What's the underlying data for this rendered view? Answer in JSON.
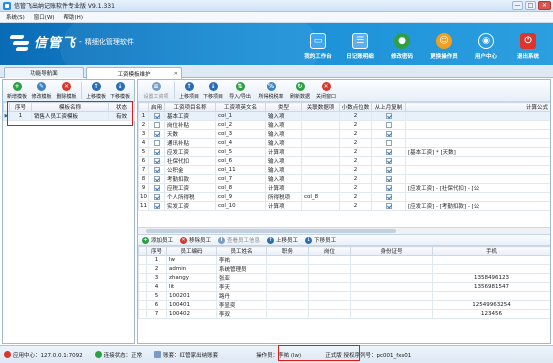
{
  "window": {
    "title": "信管飞出纳记账软件专业版 V9.1.331",
    "minimize": "—",
    "maximize": "□",
    "close": "✕"
  },
  "menu": [
    "系统(S)",
    "窗口(W)",
    "帮助(H)"
  ],
  "banner": {
    "brand": "信管飞",
    "separator": "-",
    "slogan": "精细化管理软件",
    "tools": [
      {
        "label": "我的工作台",
        "icon": "monitor-icon",
        "color": "#3fa7f0"
      },
      {
        "label": "日记账明细",
        "icon": "list-icon",
        "color": "#5cb0ee"
      },
      {
        "label": "修改密码",
        "icon": "lock-icon",
        "color": "#2ea043"
      },
      {
        "label": "更换操作员",
        "icon": "user-icon",
        "color": "#f0a020"
      },
      {
        "label": "用户中心",
        "icon": "globe-icon",
        "color": "#2a9de0"
      },
      {
        "label": "退出系统",
        "icon": "power-icon",
        "color": "#e0342a"
      }
    ]
  },
  "tabs": [
    {
      "label": "功能导航面"
    },
    {
      "label": "工资模板维护",
      "close": "✕"
    }
  ],
  "left_toolbar": [
    {
      "label": "新增模板",
      "color": "#2ea043",
      "glyph": "+"
    },
    {
      "label": "修改模板",
      "color": "#3b82c8",
      "glyph": "✎"
    },
    {
      "label": "删除模板",
      "color": "#d9362c",
      "glyph": "✕"
    },
    {
      "label": "上移模板",
      "color": "#2a6db3",
      "glyph": "↑"
    },
    {
      "label": "下移模板",
      "color": "#2a6db3",
      "glyph": "↓"
    }
  ],
  "template_table": {
    "headers": [
      "序号",
      "模板名称",
      "状态"
    ],
    "rows": [
      {
        "marker": "▶",
        "no": "1",
        "name": "销售人员工资模板",
        "status": "有效"
      }
    ]
  },
  "right_toolbar": [
    {
      "label": "设置工资项",
      "color": "#7a9cc4",
      "glyph": "≡",
      "disabled": true
    },
    {
      "label": "上移项目",
      "color": "#2a6db3",
      "glyph": "↑"
    },
    {
      "label": "下移项目",
      "color": "#2a6db3",
      "glyph": "↓"
    },
    {
      "label": "导入/导出",
      "color": "#2ea043",
      "glyph": "⇅"
    },
    {
      "label": "所得税税率",
      "color": "#3b82c8",
      "glyph": "%"
    },
    {
      "label": "刷新数据",
      "color": "#2ea043",
      "glyph": "↻"
    },
    {
      "label": "关闭窗口",
      "color": "#d9362c",
      "glyph": "✕"
    }
  ],
  "items_table": {
    "headers": [
      "",
      "启用",
      "工资项目名称",
      "工资项英文名",
      "类型",
      "关联数据项",
      "小数点位数",
      "从上月复制",
      "计算公式"
    ],
    "rows": [
      {
        "no": "1",
        "enabled": true,
        "name": "基本工资",
        "en": "col_1",
        "type": "输入项",
        "rel": "",
        "dec": "2",
        "copy": true,
        "formula": ""
      },
      {
        "no": "2",
        "enabled": false,
        "name": "岗位补贴",
        "en": "col_2",
        "type": "输入项",
        "rel": "",
        "dec": "2",
        "copy": false,
        "formula": ""
      },
      {
        "no": "3",
        "enabled": true,
        "name": "天数",
        "en": "col_3",
        "type": "输入项",
        "rel": "",
        "dec": "2",
        "copy": true,
        "formula": ""
      },
      {
        "no": "4",
        "enabled": false,
        "name": "通讯补贴",
        "en": "col_4",
        "type": "输入项",
        "rel": "",
        "dec": "2",
        "copy": false,
        "formula": ""
      },
      {
        "no": "5",
        "enabled": true,
        "name": "应发工资",
        "en": "col_5",
        "type": "计算项",
        "rel": "",
        "dec": "2",
        "copy": true,
        "formula": "[基本工资] * [天数]"
      },
      {
        "no": "6",
        "enabled": true,
        "name": "社保代扣",
        "en": "col_6",
        "type": "输入项",
        "rel": "",
        "dec": "2",
        "copy": true,
        "formula": ""
      },
      {
        "no": "7",
        "enabled": true,
        "name": "公积金",
        "en": "col_11",
        "type": "输入项",
        "rel": "",
        "dec": "2",
        "copy": true,
        "formula": ""
      },
      {
        "no": "8",
        "enabled": true,
        "name": "考勤扣款",
        "en": "col_7",
        "type": "输入项",
        "rel": "",
        "dec": "2",
        "copy": true,
        "formula": ""
      },
      {
        "no": "9",
        "enabled": true,
        "name": "应税工资",
        "en": "col_8",
        "type": "计算项",
        "rel": "",
        "dec": "2",
        "copy": true,
        "formula": "[应发工资] - [社保代扣] - [公"
      },
      {
        "no": "10",
        "enabled": true,
        "name": "个人所得税",
        "en": "col_9",
        "type": "所得税项",
        "rel": "col_8",
        "dec": "2",
        "copy": true,
        "formula": ""
      },
      {
        "no": "11",
        "enabled": true,
        "name": "实发工资",
        "en": "col_10",
        "type": "计算项",
        "rel": "",
        "dec": "2",
        "copy": true,
        "formula": "[应发工资] - [考勤扣款] - [公"
      }
    ]
  },
  "staff_bar": [
    {
      "label": "添加员工",
      "color": "#2ea043",
      "glyph": "+",
      "disabled": false
    },
    {
      "label": "移除员工",
      "color": "#d9362c",
      "glyph": "✕",
      "disabled": false
    },
    {
      "label": "查看员工信息",
      "color": "#7a9cc4",
      "glyph": "i",
      "disabled": true
    },
    {
      "label": "上移员工",
      "color": "#2a6db3",
      "glyph": "↑",
      "disabled": false
    },
    {
      "label": "下移员工",
      "color": "#2a6db3",
      "glyph": "↓",
      "disabled": false
    }
  ],
  "staff_table": {
    "headers": [
      "",
      "序号",
      "员工编码",
      "员工姓名",
      "职务",
      "岗位",
      "身份证号",
      "手机"
    ],
    "rows": [
      {
        "no": "1",
        "code": "lw",
        "name": "李祐",
        "duty": "",
        "post": "",
        "id": "",
        "phone": ""
      },
      {
        "no": "2",
        "code": "admin",
        "name": "系统管理员",
        "duty": "",
        "post": "",
        "id": "",
        "phone": ""
      },
      {
        "no": "3",
        "code": "zhangy",
        "name": "张亚",
        "duty": "",
        "post": "",
        "id": "",
        "phone": "1358496123"
      },
      {
        "no": "4",
        "code": "lit",
        "name": "李天",
        "duty": "",
        "post": "",
        "id": "",
        "phone": "1356981547"
      },
      {
        "no": "5",
        "code": "100201",
        "name": "路丹",
        "duty": "",
        "post": "",
        "id": "",
        "phone": ""
      },
      {
        "no": "6",
        "code": "100401",
        "name": "李显奕",
        "duty": "",
        "post": "",
        "id": "",
        "phone": "12549963254"
      },
      {
        "no": "7",
        "code": "100402",
        "name": "李双",
        "duty": "",
        "post": "",
        "id": "",
        "phone": "123456"
      }
    ]
  },
  "status_bar": {
    "app_center": "应用中心：127.0.0.1:7092",
    "connection": "连接状态：正常",
    "account_set": "账套：红管家出纳账套",
    "operator": "操作员：李祐 (lw)",
    "edition": "正式版 授权序列号：pc001_fxs01"
  },
  "colors": {
    "accent": "#1a8ed6",
    "highlight_box": "#e0191d"
  }
}
